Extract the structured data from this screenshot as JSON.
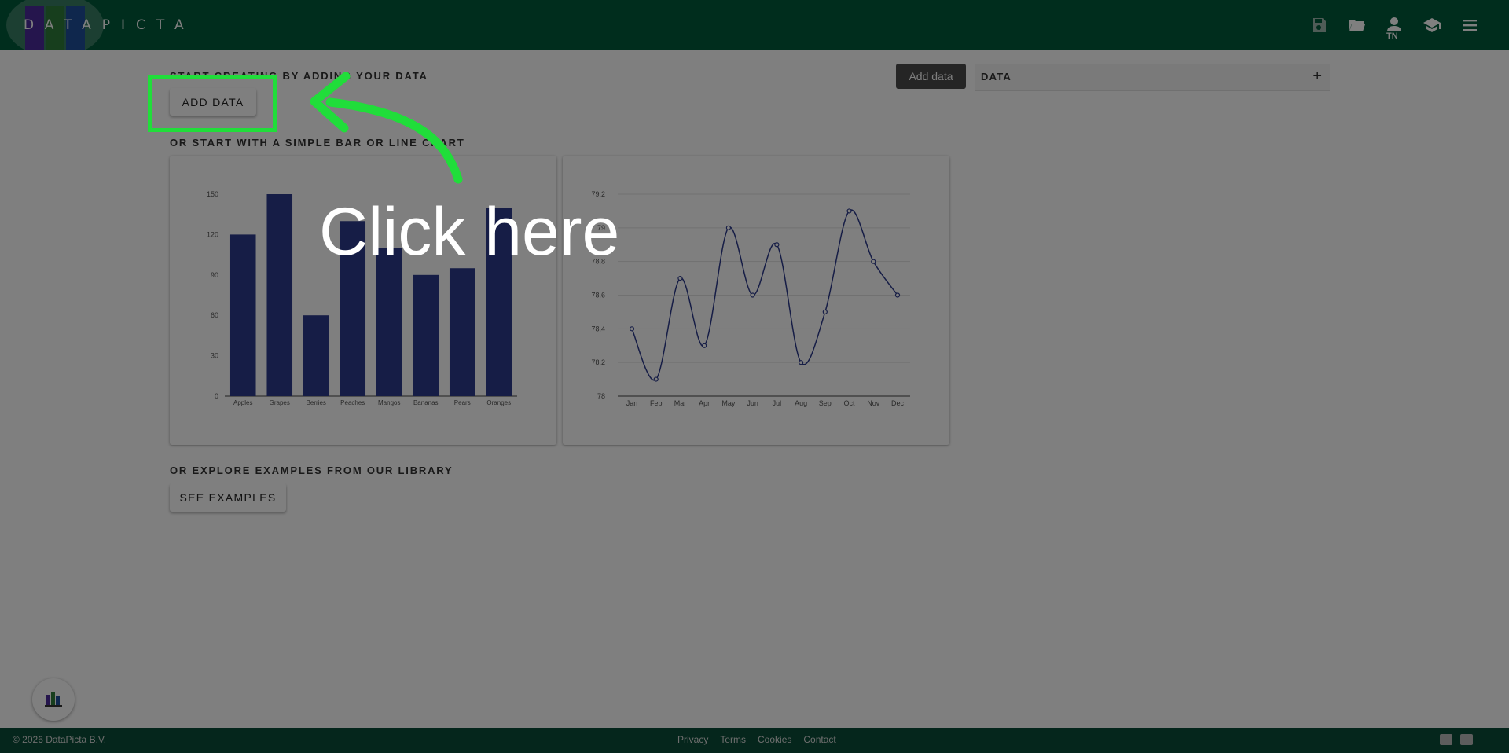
{
  "header": {
    "logo_text": "DATAPICTA",
    "icons": [
      "save-icon",
      "folder-open-icon",
      "user-icon",
      "school-icon",
      "menu-icon"
    ],
    "user_initials": "TN",
    "color": "#005a3a"
  },
  "main": {
    "start_label": "START CREATING BY ADDING YOUR DATA",
    "add_data_button": "ADD DATA",
    "simple_label": "OR START WITH A SIMPLE BAR OR LINE CHART",
    "explore_label": "OR EXPLORE EXAMPLES FROM OUR LIBRARY",
    "see_examples_button": "SEE EXAMPLES",
    "add_data_dark_button": "Add data",
    "data_panel_label": "DATA",
    "data_panel_plus": "+"
  },
  "overlay": {
    "click_text": "Click here",
    "highlight_color": "#20dd3a"
  },
  "footer": {
    "copyright": "© 2026 DataPicta B.V.",
    "links": [
      "Privacy",
      "Terms",
      "Cookies",
      "Contact"
    ],
    "icons": [
      "youtube-icon",
      "linkedin-icon"
    ]
  },
  "chart_data": [
    {
      "type": "bar",
      "categories": [
        "Apples",
        "Grapes",
        "Berries",
        "Peaches",
        "Mangos",
        "Bananas",
        "Pears",
        "Oranges"
      ],
      "values": [
        120,
        150,
        60,
        130,
        110,
        90,
        95,
        140
      ],
      "ylim": [
        0,
        150
      ],
      "yticks": [
        0,
        30,
        60,
        90,
        120,
        150
      ],
      "color": "#2d3a8c",
      "grid": false
    },
    {
      "type": "line",
      "categories": [
        "Jan",
        "Feb",
        "Mar",
        "Apr",
        "May",
        "Jun",
        "Jul",
        "Aug",
        "Sep",
        "Oct",
        "Nov",
        "Dec"
      ],
      "values": [
        78.4,
        78.1,
        78.7,
        78.3,
        79.0,
        78.6,
        78.9,
        78.2,
        78.5,
        79.1,
        78.8,
        78.6
      ],
      "ylim": [
        78,
        79.2
      ],
      "yticks": [
        "78",
        "78.2",
        "78.4",
        "78.6",
        "78.8",
        "79",
        "79.2"
      ],
      "color": "#2d3a8c",
      "grid": true
    }
  ]
}
